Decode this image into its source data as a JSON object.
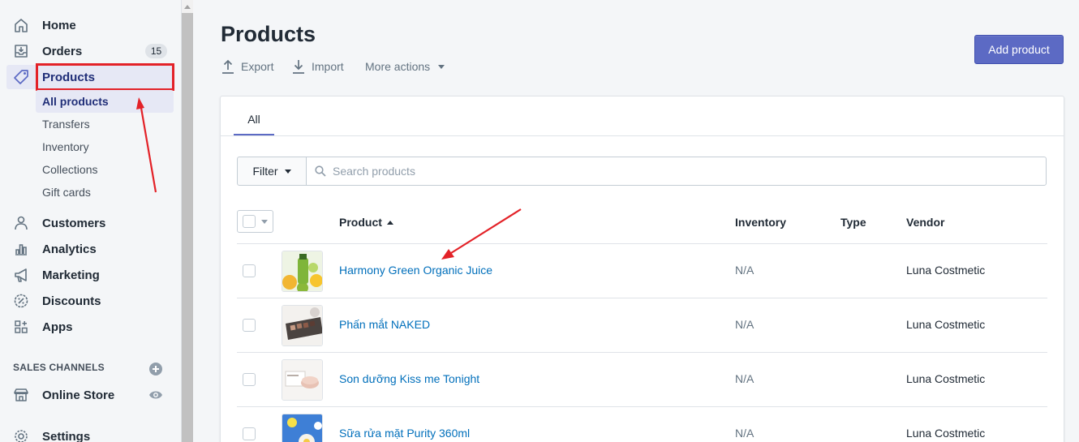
{
  "sidebar": {
    "home": "Home",
    "orders": "Orders",
    "orders_badge": "15",
    "products": "Products",
    "products_sub": [
      "All products",
      "Transfers",
      "Inventory",
      "Collections",
      "Gift cards"
    ],
    "customers": "Customers",
    "analytics": "Analytics",
    "marketing": "Marketing",
    "discounts": "Discounts",
    "apps": "Apps",
    "sales_channels_title": "SALES CHANNELS",
    "online_store": "Online Store",
    "settings": "Settings"
  },
  "header": {
    "title": "Products",
    "export_label": "Export",
    "import_label": "Import",
    "more_actions_label": "More actions",
    "add_product_label": "Add product"
  },
  "tabs": {
    "all_label": "All"
  },
  "filter": {
    "label": "Filter",
    "search_placeholder": "Search products"
  },
  "table": {
    "columns": {
      "product": "Product",
      "inventory": "Inventory",
      "type": "Type",
      "vendor": "Vendor"
    },
    "rows": [
      {
        "name": "Harmony Green Organic Juice",
        "inventory": "N/A",
        "type": "",
        "vendor": "Luna Costmetic"
      },
      {
        "name": "Phấn mắt NAKED",
        "inventory": "N/A",
        "type": "",
        "vendor": "Luna Costmetic"
      },
      {
        "name": "Son dưỡng Kiss me Tonight",
        "inventory": "N/A",
        "type": "",
        "vendor": "Luna Costmetic"
      },
      {
        "name": "Sữa rửa mặt Purity 360ml",
        "inventory": "N/A",
        "type": "",
        "vendor": "Luna Costmetic"
      }
    ]
  },
  "colors": {
    "accent": "#5c6ac4",
    "link": "#006fbb",
    "annotation_red": "#e32228"
  }
}
